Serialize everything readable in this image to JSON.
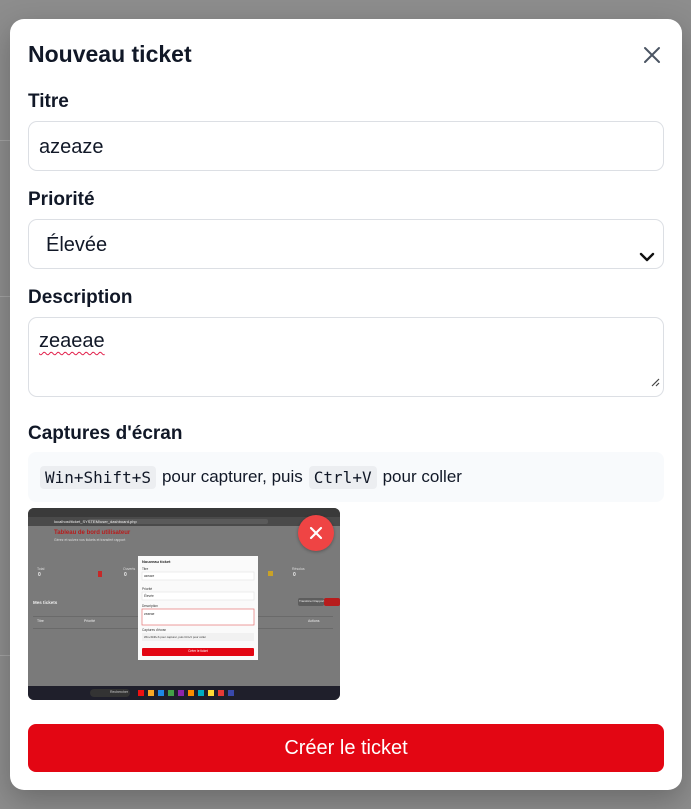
{
  "modal": {
    "title": "Nouveau ticket",
    "close_icon": "close-icon"
  },
  "form": {
    "title_label": "Titre",
    "title_value": "azeaze",
    "priority_label": "Priorité",
    "priority_value": "Élevée",
    "description_label": "Description",
    "description_value": "zeaeae",
    "screenshots_label": "Captures d'écran",
    "hint": {
      "key1": "Win+Shift+S",
      "text1": "pour capturer, puis",
      "key2": "Ctrl+V",
      "text2": "pour coller"
    },
    "thumbnail": {
      "browser_url": "localhost/ticket_SYSTEM/user_dashboard.php",
      "app_title": "Tableau de bord utilisateur",
      "app_subtitle": "Gérez et suivez vos tickets et transfert rapport",
      "section": "Mes tickets",
      "table_headers": [
        "Titre",
        "Priorité",
        "Actions"
      ],
      "stats": [
        "0",
        "0",
        "0"
      ],
      "stat_labels": [
        "Total",
        "Ouverts",
        "Résolus"
      ],
      "mini_modal": {
        "title": "Nouveau ticket",
        "labels": [
          "Titre",
          "Priorité",
          "Description",
          "Captures d'écran"
        ],
        "values": [
          "azeaze",
          "Élevée",
          "zeaeae"
        ],
        "hint": "Win+Shift+S pour capturer, puis Ctrl+V pour coller",
        "button": "Créer le ticket"
      },
      "report_button": "Transférer Rapport",
      "taskbar_search": "Rechercher"
    },
    "remove_icon": "close-icon",
    "submit_label": "Créer le ticket"
  },
  "colors": {
    "accent": "#e30613",
    "remove": "#ef4444",
    "overlay": "#8d8d8d"
  }
}
